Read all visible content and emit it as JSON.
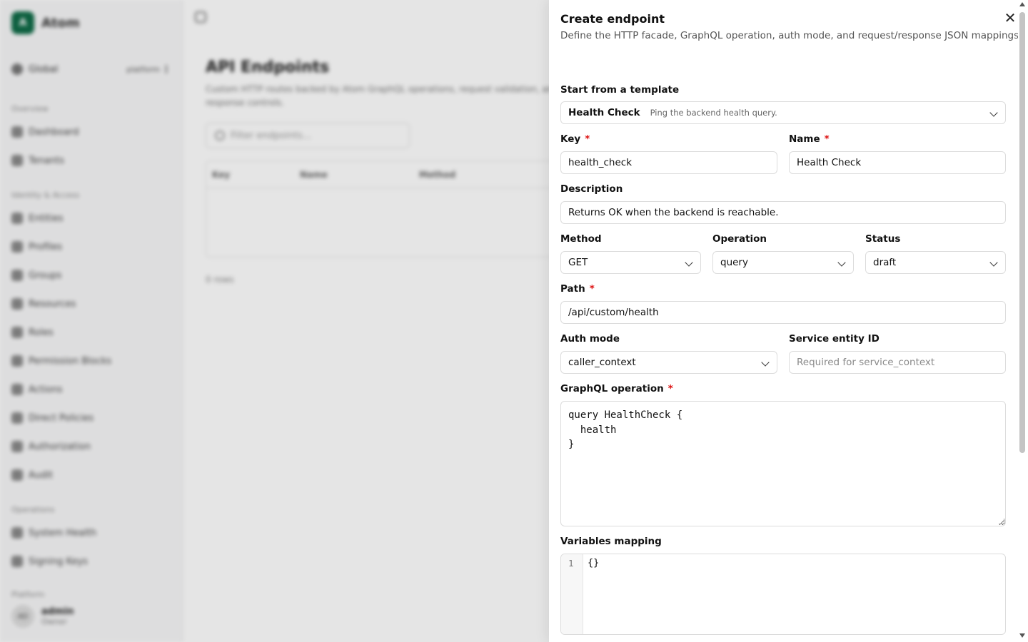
{
  "app": {
    "brand": {
      "logo_letter": "A",
      "name": "Atom"
    },
    "scope": {
      "label": "Global",
      "tag": "platform"
    },
    "sections": [
      {
        "title": "Overview",
        "items": [
          "Dashboard",
          "Tenants"
        ]
      },
      {
        "title": "Identity & Access",
        "items": [
          "Entities",
          "Profiles",
          "Groups",
          "Resources",
          "Roles",
          "Permission Blocks",
          "Actions",
          "Direct Policies",
          "Authorization",
          "Audit"
        ]
      },
      {
        "title": "Operations",
        "items": [
          "System Health",
          "Signing Keys"
        ]
      }
    ],
    "section_label_platform": "Platform",
    "user": {
      "initials": "AD",
      "name": "admin",
      "role": "Owner"
    }
  },
  "main": {
    "title": "API Endpoints",
    "subtitle": "Custom HTTP routes backed by Atom GraphQL operations, request validation, and response controls.",
    "filter_placeholder": "Filter endpoints...",
    "columns": [
      "Key",
      "Name",
      "Method"
    ],
    "rows_count": "0 rows"
  },
  "panel": {
    "title": "Create endpoint",
    "description": "Define the HTTP facade, GraphQL operation, auth mode, and request/response JSON mappings.",
    "template": {
      "label": "Start from a template",
      "name": "Health Check",
      "description": "Ping the backend health query."
    },
    "key": {
      "label": "Key",
      "value": "health_check"
    },
    "name": {
      "label": "Name",
      "value": "Health Check"
    },
    "description_field": {
      "label": "Description",
      "value": "Returns OK when the backend is reachable."
    },
    "method": {
      "label": "Method",
      "value": "GET"
    },
    "operation": {
      "label": "Operation",
      "value": "query"
    },
    "status": {
      "label": "Status",
      "value": "draft"
    },
    "path": {
      "label": "Path",
      "value": "/api/custom/health"
    },
    "auth_mode": {
      "label": "Auth mode",
      "value": "caller_context"
    },
    "service_entity": {
      "label": "Service entity ID",
      "placeholder": "Required for service_context"
    },
    "graphql": {
      "label": "GraphQL operation",
      "value": "query HealthCheck {\n  health\n}"
    },
    "variables": {
      "label": "Variables mapping",
      "line_number": "1",
      "value": "{}"
    },
    "required_mark": "*"
  },
  "colors": {
    "brand": "#0f6b47",
    "required": "#dd1111"
  }
}
